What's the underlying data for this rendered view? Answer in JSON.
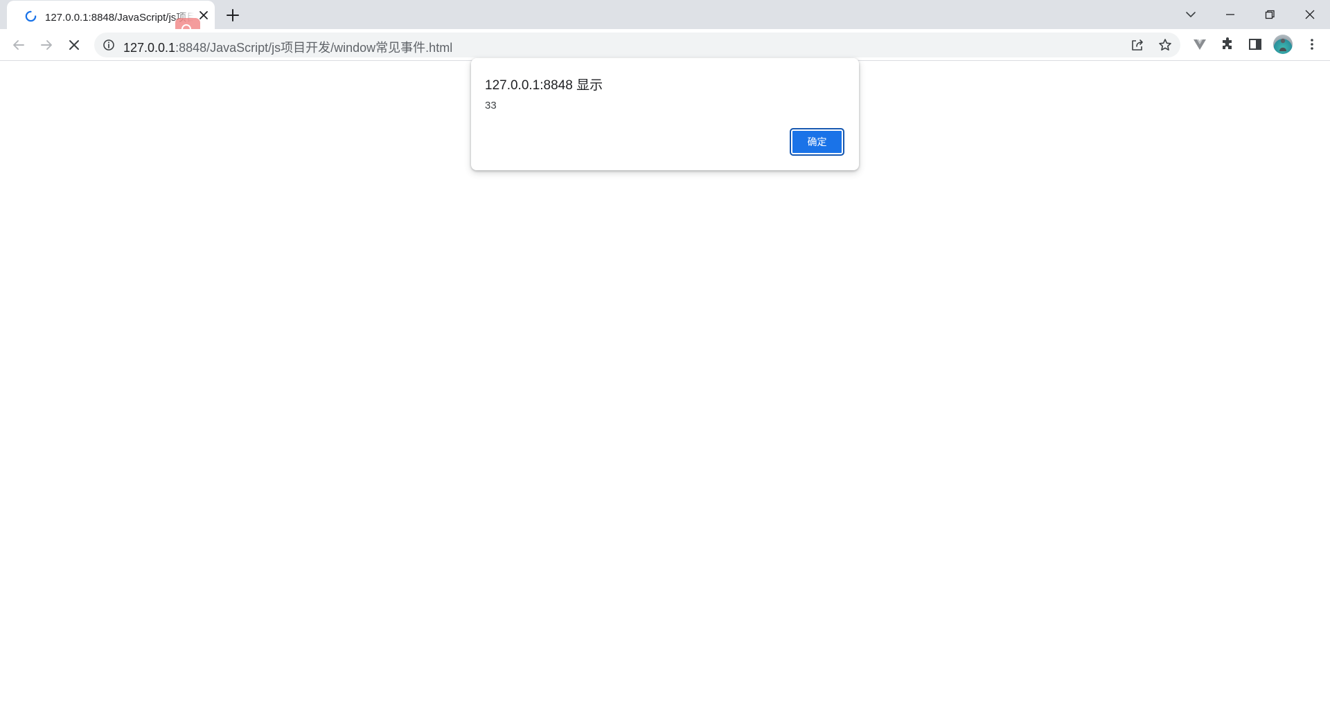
{
  "browser": {
    "tab": {
      "title": "127.0.0.1:8848/JavaScript/js项目开发/window常见事件.html",
      "loading": true
    },
    "omnibox": {
      "host": "127.0.0.1",
      "path": ":8848/JavaScript/js项目开发/window常见事件.html"
    },
    "icons": {
      "tab_spinner": "loading-spinner-icon",
      "tab_close": "close-icon",
      "new_tab": "plus-icon",
      "tab_search": "chevron-down-icon",
      "minimize": "minimize-icon",
      "restore": "restore-icon",
      "close_window": "close-icon",
      "back": "arrow-left-icon",
      "forward": "arrow-right-icon",
      "stop": "stop-x-icon",
      "site_info": "info-icon",
      "share": "share-icon",
      "bookmark": "star-icon",
      "extension_vue": "vue-devtools-icon",
      "extensions": "puzzle-icon",
      "side_panel": "side-panel-icon",
      "profile": "avatar",
      "menu": "kebab-menu-icon",
      "screen_search_overlay": "search-icon"
    },
    "colors": {
      "tabstrip_bg": "#dee1e6",
      "accent": "#1a73e8",
      "omnibox_bg": "#f1f3f4"
    }
  },
  "alert": {
    "title": "127.0.0.1:8848 显示",
    "message": "33",
    "ok_label": "确定"
  }
}
